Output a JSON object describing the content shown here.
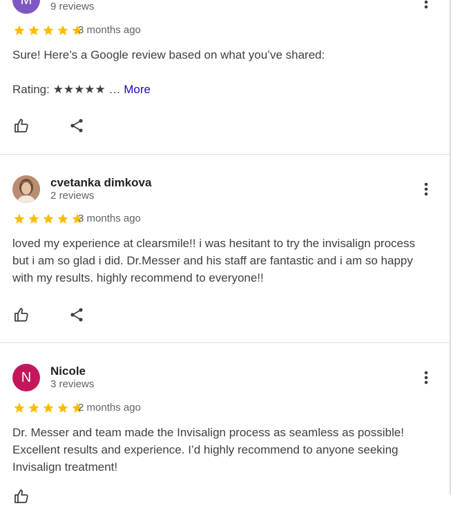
{
  "reviews": [
    {
      "avatar_initial": "M",
      "avatar_color": "#7e57c2",
      "review_count": "9 reviews",
      "rating": 5,
      "date": "3 months ago",
      "text_line1": "Sure! Here’s a Google review based on what you’ve shared:",
      "text_line2_prefix": "Rating: ★★★★★ …",
      "more_label": "More"
    },
    {
      "avatar_type": "photo",
      "name": "cvetanka dimkova",
      "review_count": "2 reviews",
      "rating": 5,
      "date": "3 months ago",
      "text": "loved my experience at clearsmile!! i was hesitant to try the invisalign process but i am so glad i did. Dr.Messer and his staff are fantastic and i am so happy with my results. highly recommend to everyone!!"
    },
    {
      "avatar_initial": "N",
      "avatar_color": "#c2185b",
      "name": "Nicole",
      "review_count": "3 reviews",
      "rating": 5,
      "date": "2 months ago",
      "text": "Dr. Messer and team made the Invisalign process as seamless as possible! Excellent results and experience. I’d highly recommend to anyone seeking Invisalign treatment!"
    }
  ],
  "colors": {
    "star": "#fbbc04",
    "link": "#1a0dab",
    "divider": "#dadce0",
    "icon": "#3c4043"
  },
  "icons": {
    "like": "thumb-up-icon",
    "share": "share-icon",
    "menu": "more-vert-icon"
  }
}
